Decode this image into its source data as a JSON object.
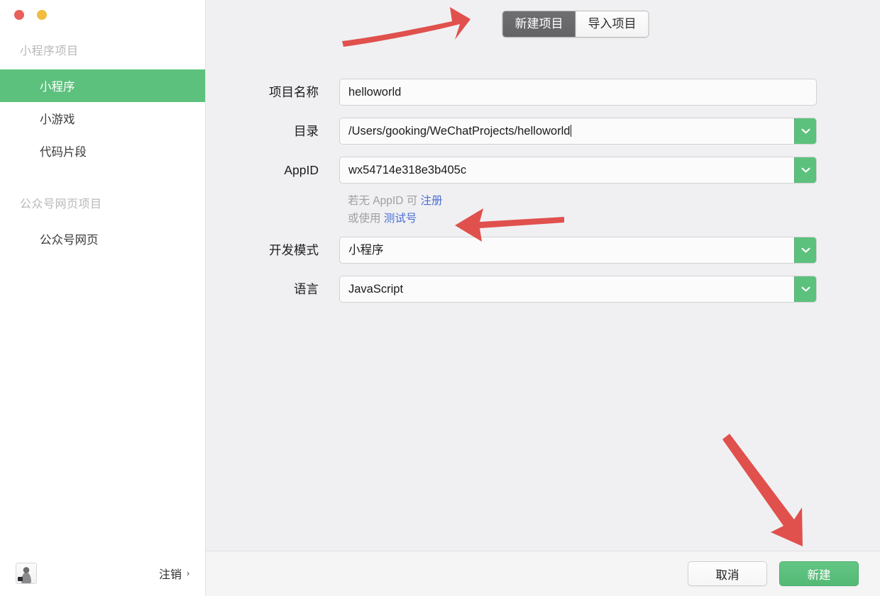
{
  "window": {
    "traffic_lights": [
      {
        "name": "close",
        "color": "#e8605a"
      },
      {
        "name": "minimize",
        "color": "#f2bc41"
      }
    ]
  },
  "sidebar": {
    "groups": [
      {
        "title": "小程序项目",
        "items": [
          {
            "label": "小程序",
            "active": true
          },
          {
            "label": "小游戏",
            "active": false
          },
          {
            "label": "代码片段",
            "active": false
          }
        ]
      },
      {
        "title": "公众号网页项目",
        "items": [
          {
            "label": "公众号网页",
            "active": false
          }
        ]
      }
    ],
    "footer": {
      "logout_label": "注销",
      "logout_chevron": "›",
      "avatar_name": "user-avatar"
    },
    "active_color": "#5cc17d"
  },
  "tabs": [
    {
      "label": "新建项目",
      "active": true
    },
    {
      "label": "导入项目",
      "active": false
    }
  ],
  "form": {
    "fields": [
      {
        "label": "项目名称",
        "value": "helloworld",
        "placeholder": "",
        "type": "text",
        "has_dropdown": false,
        "caret": false
      },
      {
        "label": "目录",
        "value": "/Users/gooking/WeChatProjects/helloworld",
        "placeholder": "",
        "type": "text",
        "has_dropdown": true,
        "caret": true
      },
      {
        "label": "AppID",
        "value": "wx54714e318e3b405c",
        "placeholder": "",
        "type": "text",
        "has_dropdown": true,
        "caret": false
      },
      {
        "label": "开发模式",
        "value": "小程序",
        "placeholder": "",
        "type": "select",
        "has_dropdown": true,
        "caret": false
      },
      {
        "label": "语言",
        "value": "JavaScript",
        "placeholder": "",
        "type": "select",
        "has_dropdown": true,
        "caret": false
      }
    ],
    "hint": {
      "line1_prefix": "若无 AppID 可 ",
      "line1_link": "注册",
      "line2_prefix": "或使用 ",
      "line2_link": "测试号",
      "link_color": "#4a6fd4"
    }
  },
  "footer": {
    "cancel_label": "取消",
    "create_label": "新建",
    "primary_color": "#5cc17d"
  },
  "annotations": {
    "arrow_color": "#e0504d",
    "arrows": [
      {
        "name": "arrow-to-new-project-tab",
        "direction": "right-up"
      },
      {
        "name": "arrow-to-test-account-link",
        "direction": "left"
      },
      {
        "name": "arrow-to-create-button",
        "direction": "down-right"
      }
    ]
  }
}
